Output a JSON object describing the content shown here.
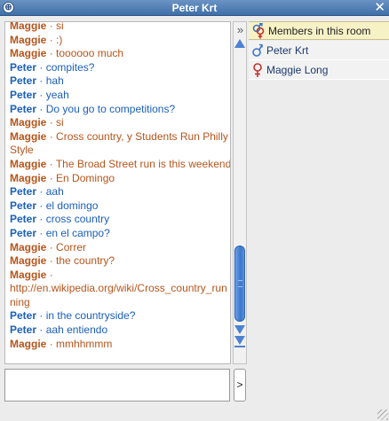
{
  "window": {
    "title": "Peter Krt",
    "title_icon": "globe-icon",
    "close_label": "✕"
  },
  "chat": {
    "messages": [
      {
        "sender": "Maggie",
        "separator": "·",
        "text": "si",
        "color": "#b8541a"
      },
      {
        "sender": "Maggie",
        "separator": "·",
        "text": ":)",
        "color": "#b8541a"
      },
      {
        "sender": "Maggie",
        "separator": "·",
        "text": "toooooo much",
        "color": "#b8541a"
      },
      {
        "sender": "Peter",
        "separator": "·",
        "text": "compites?",
        "color": "#1a5fb8"
      },
      {
        "sender": "Peter",
        "separator": "·",
        "text": "hah",
        "color": "#1a5fb8"
      },
      {
        "sender": "Peter",
        "separator": "·",
        "text": "yeah",
        "color": "#1a5fb8"
      },
      {
        "sender": "Peter",
        "separator": "·",
        "text": "Do you go to competitions?",
        "color": "#1a5fb8"
      },
      {
        "sender": "Maggie",
        "separator": "·",
        "text": "si",
        "color": "#b8541a"
      },
      {
        "sender": "Maggie",
        "separator": "·",
        "text": "Cross country, y Students Run Philly Style",
        "color": "#b8541a"
      },
      {
        "sender": "Maggie",
        "separator": "·",
        "text": "The Broad Street run is this weekend",
        "color": "#b8541a"
      },
      {
        "sender": "Maggie",
        "separator": "·",
        "text": "En Domingo",
        "color": "#b8541a"
      },
      {
        "sender": "Peter",
        "separator": "·",
        "text": "aah",
        "color": "#1a5fb8"
      },
      {
        "sender": "Peter",
        "separator": "·",
        "text": "el domingo",
        "color": "#1a5fb8"
      },
      {
        "sender": "Peter",
        "separator": "·",
        "text": "cross country",
        "color": "#1a5fb8"
      },
      {
        "sender": "Peter",
        "separator": "·",
        "text": "en el campo?",
        "color": "#1a5fb8"
      },
      {
        "sender": "Maggie",
        "separator": "·",
        "text": "Correr",
        "color": "#b8541a"
      },
      {
        "sender": "Maggie",
        "separator": "·",
        "text": "the country?",
        "color": "#b8541a"
      },
      {
        "sender": "Maggie",
        "separator": "·",
        "text": "http://en.wikipedia.org/wiki/Cross_country_running",
        "color": "#b8541a"
      },
      {
        "sender": "Peter",
        "separator": "·",
        "text": "in the countryside?",
        "color": "#1a5fb8"
      },
      {
        "sender": "Peter",
        "separator": "·",
        "text": "aah entiendo",
        "color": "#1a5fb8"
      },
      {
        "sender": "Maggie",
        "separator": "·",
        "text": "mmhhmmm",
        "color": "#b8541a"
      }
    ],
    "input_value": "",
    "send_label": ">",
    "collapse_label": "»"
  },
  "members": {
    "header_label": "Members in this room",
    "header_icon": "male-female-icon",
    "list": [
      {
        "name": "Peter Krt",
        "gender_icon": "male-icon",
        "symbol": "♂"
      },
      {
        "name": "Maggie Long",
        "gender_icon": "female-icon",
        "symbol": "♀"
      }
    ]
  },
  "colors": {
    "title_bar": "#3f6fa8",
    "maggie": "#b8541a",
    "peter": "#1a5fb8",
    "members_header_bg": "#f7f2c6",
    "scroll_accent": "#4d82d1"
  }
}
